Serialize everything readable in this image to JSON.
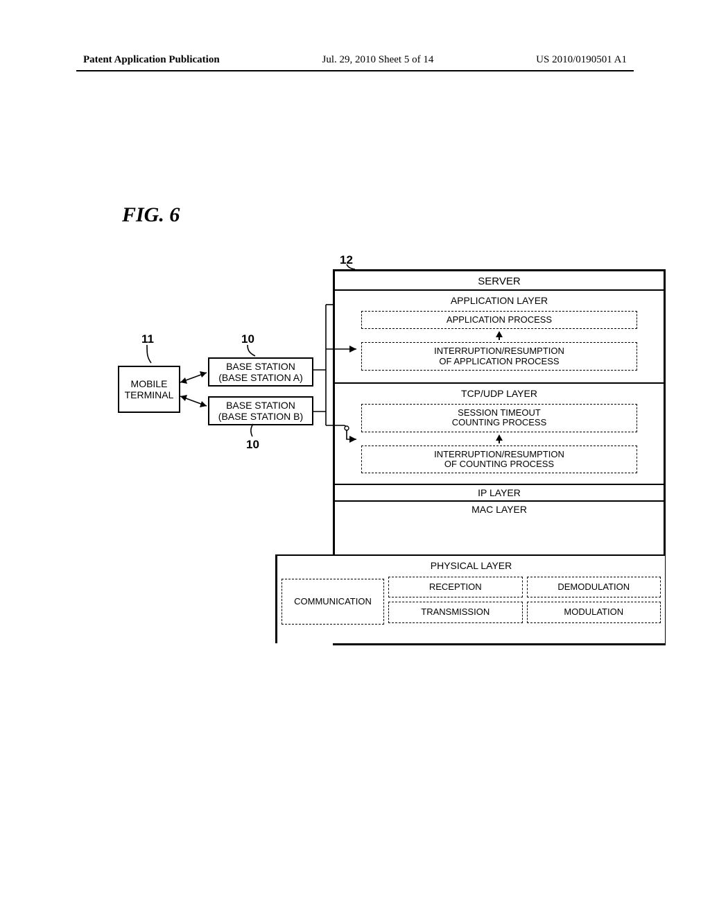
{
  "header": {
    "left": "Patent Application Publication",
    "center": "Jul. 29, 2010  Sheet 5 of 14",
    "right": "US 2010/0190501 A1"
  },
  "figure": {
    "label": "FIG. 6",
    "refs": {
      "mobile": "11",
      "bsA": "10",
      "bsB": "10",
      "server": "12"
    },
    "mobile_terminal": "MOBILE\nTERMINAL",
    "base_station_a": "BASE STATION\n(BASE STATION A)",
    "base_station_b": "BASE STATION\n(BASE STATION B)",
    "server": {
      "title": "SERVER",
      "app_layer": {
        "title": "APPLICATION LAYER",
        "proc": "APPLICATION PROCESS",
        "intres": "INTERRUPTION/RESUMPTION\nOF APPLICATION PROCESS"
      },
      "tcp_layer": {
        "title": "TCP/UDP LAYER",
        "proc": "SESSION TIMEOUT\nCOUNTING PROCESS",
        "intres": "INTERRUPTION/RESUMPTION\nOF COUNTING PROCESS"
      },
      "ip": "IP LAYER",
      "mac": "MAC LAYER",
      "phys": {
        "title": "PHYSICAL LAYER",
        "comm": "COMMUNICATION",
        "rx": "RECEPTION",
        "demod": "DEMODULATION",
        "tx": "TRANSMISSION",
        "mod": "MODULATION"
      }
    }
  }
}
